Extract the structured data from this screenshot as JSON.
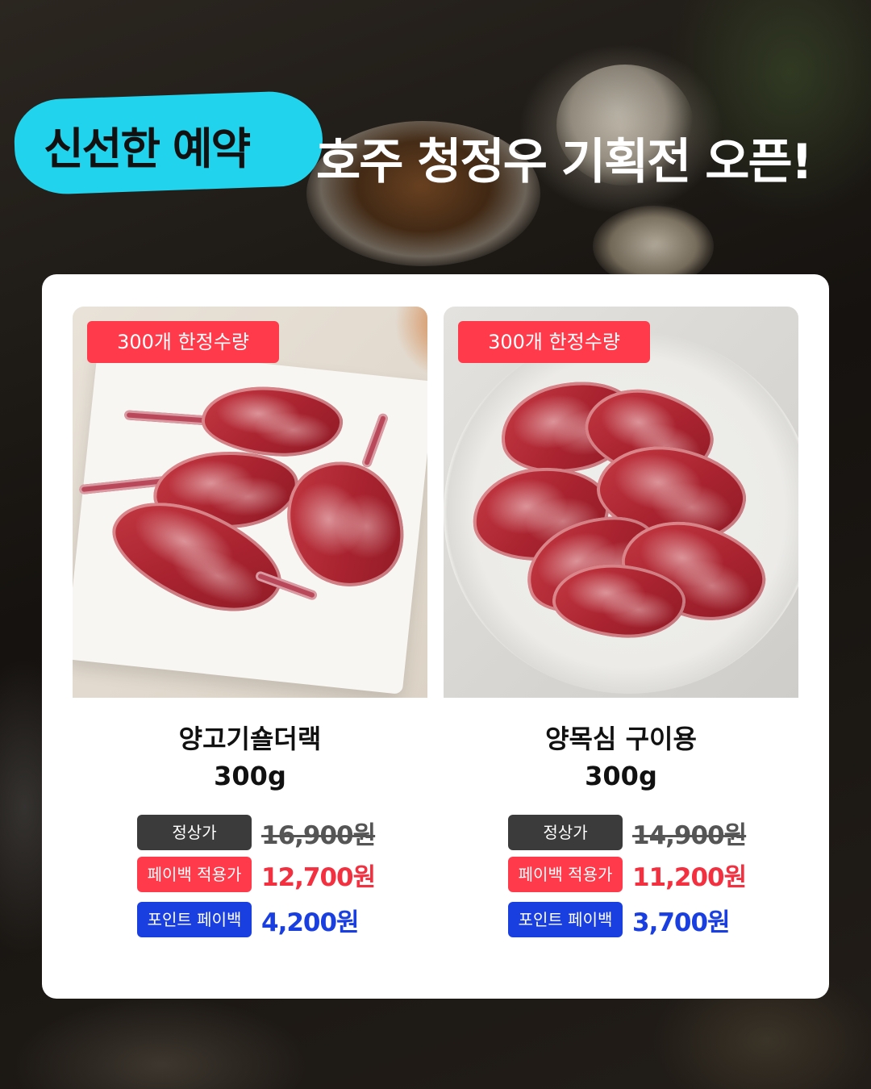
{
  "header": {
    "highlight": "신선한 예약",
    "title": "호주 청정우 기획전 오픈!"
  },
  "colors": {
    "highlight_bg": "#21d3ec",
    "badge_red": "#ff3a4a",
    "payback_blue": "#1a3fe0",
    "regular_gray": "#3b3b3b"
  },
  "products": [
    {
      "badge": "300개 한정수량",
      "name_line1": "양고기숄더랙",
      "name_line2": "300g",
      "regular_label": "정상가",
      "regular_price": "16,900원",
      "payback_label": "페이백 적용가",
      "payback_price": "12,700원",
      "point_label": "포인트 페이백",
      "point_price": "4,200원",
      "image": "lamb-shoulder-rack-photo"
    },
    {
      "badge": "300개 한정수량",
      "name_line1": "양목심 구이용",
      "name_line2": "300g",
      "regular_label": "정상가",
      "regular_price": "14,900원",
      "payback_label": "페이백 적용가",
      "payback_price": "11,200원",
      "point_label": "포인트 페이백",
      "point_price": "3,700원",
      "image": "lamb-neck-slices-photo"
    }
  ]
}
